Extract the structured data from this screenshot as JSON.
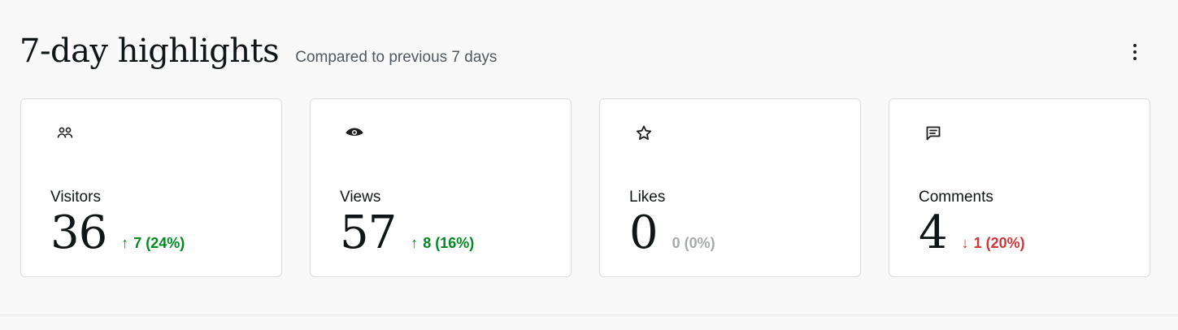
{
  "header": {
    "title": "7-day highlights",
    "subtitle": "Compared to previous 7 days",
    "more_icon": "more-vertical-icon"
  },
  "colors": {
    "up": "#008a20",
    "down": "#d63638",
    "flat": "#a7aaad"
  },
  "cards": [
    {
      "icon": "people-icon",
      "label": "Visitors",
      "value": "36",
      "arrow": "↑",
      "change": "7 (24%)",
      "trend": "up"
    },
    {
      "icon": "eye-icon",
      "label": "Views",
      "value": "57",
      "arrow": "↑",
      "change": "8 (16%)",
      "trend": "up"
    },
    {
      "icon": "star-icon",
      "label": "Likes",
      "value": "0",
      "arrow": "",
      "change": "0 (0%)",
      "trend": "flat"
    },
    {
      "icon": "comment-icon",
      "label": "Comments",
      "value": "4",
      "arrow": "↓",
      "change": "1 (20%)",
      "trend": "down"
    }
  ]
}
